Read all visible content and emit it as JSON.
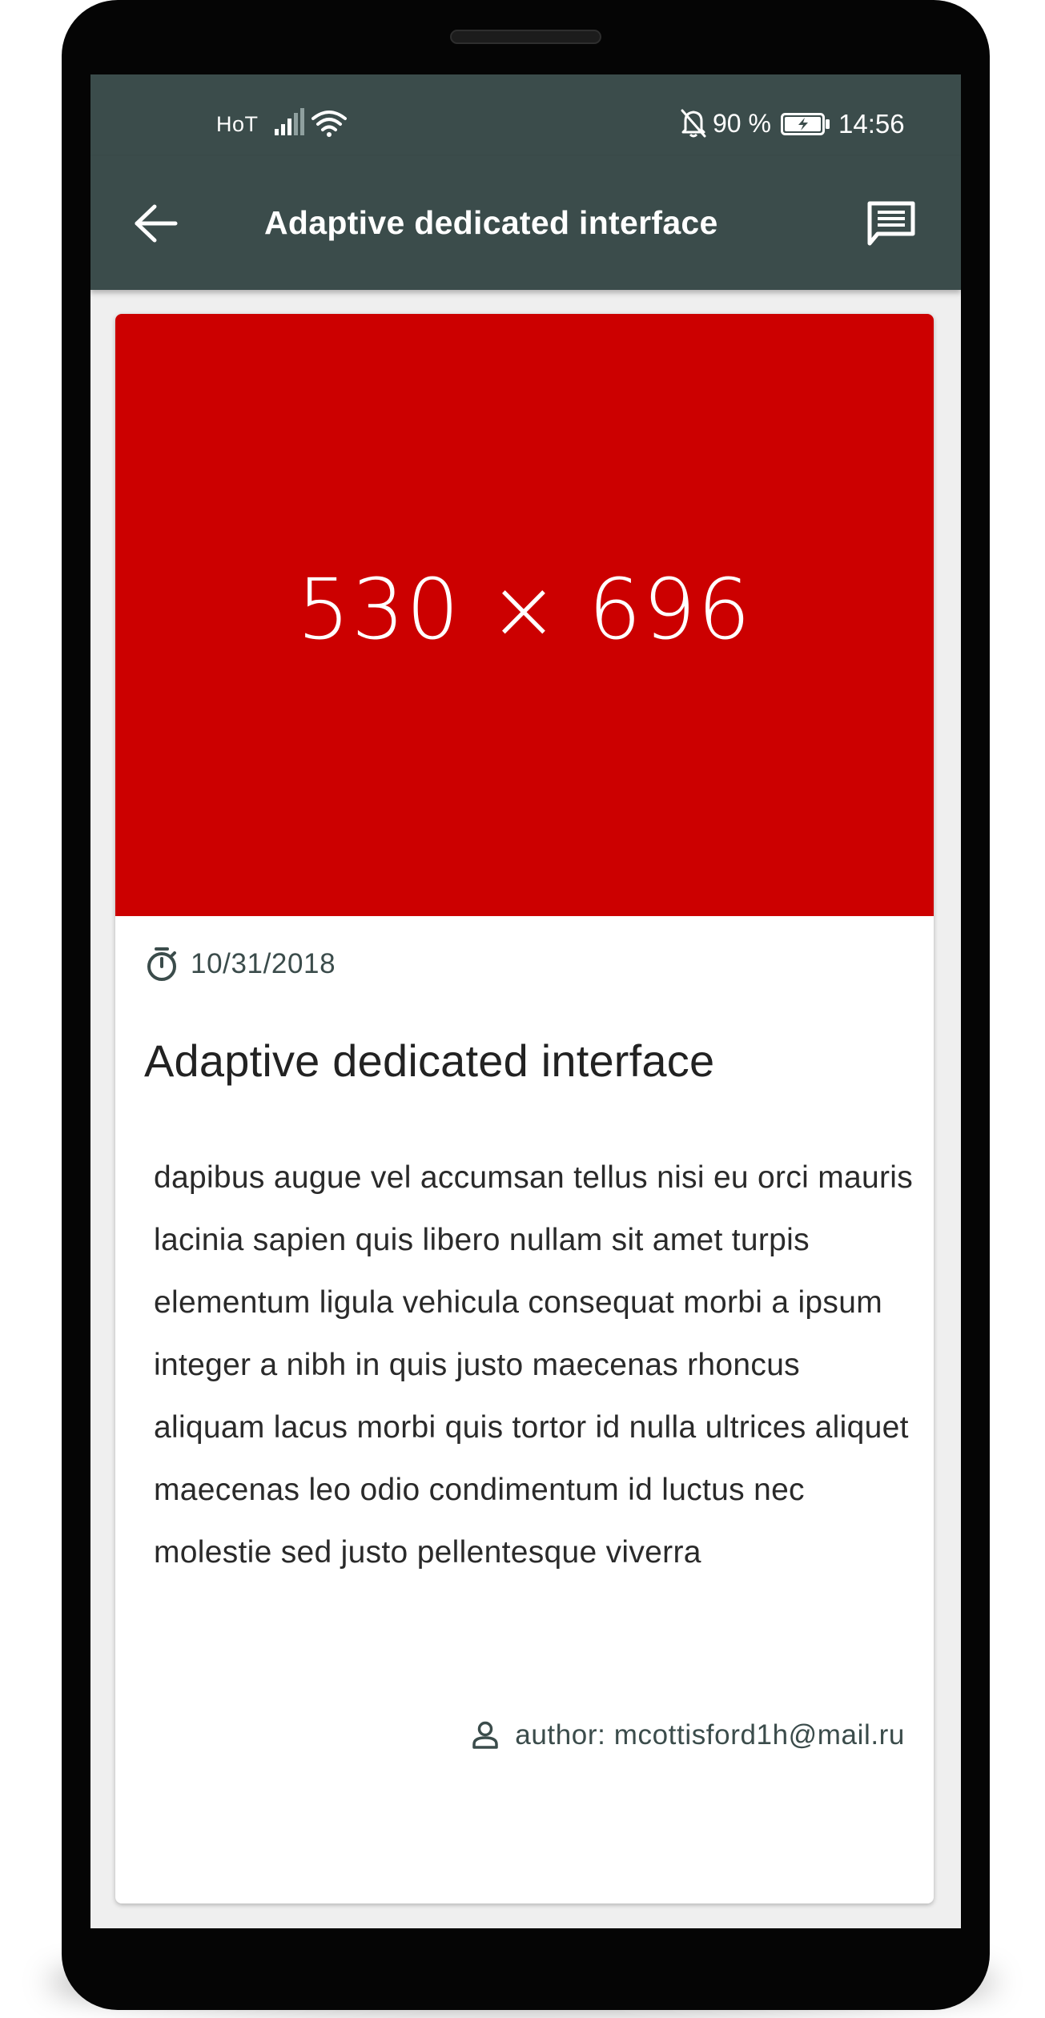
{
  "status_bar": {
    "carrier": "HoT",
    "battery_percent": "90 %",
    "time": "14:56",
    "icons": [
      "signal-icon",
      "wifi-icon",
      "bell-off-icon",
      "battery-charging-icon"
    ]
  },
  "app_bar": {
    "title": "Adaptive dedicated interface",
    "back_icon": "arrow-back-icon",
    "comments_icon": "comment-icon"
  },
  "post": {
    "image_label": "530 × 696",
    "date": "10/31/2018",
    "title": "Adaptive dedicated interface",
    "body": "dapibus augue vel accumsan tellus nisi eu orci mauris lacinia sapien quis libero nullam sit amet turpis elementum ligula vehicula consequat morbi a ipsum integer a nibh in quis justo maecenas rhoncus aliquam lacus morbi quis tortor id nulla ultrices aliquet maecenas leo odio condimentum id luctus nec molestie sed justo pellentesque viverra",
    "author": "author: mcottisford1h@mail.ru"
  },
  "colors": {
    "primary": "#3b4c4b",
    "image_placeholder": "#cc0000",
    "background": "#efefef"
  }
}
